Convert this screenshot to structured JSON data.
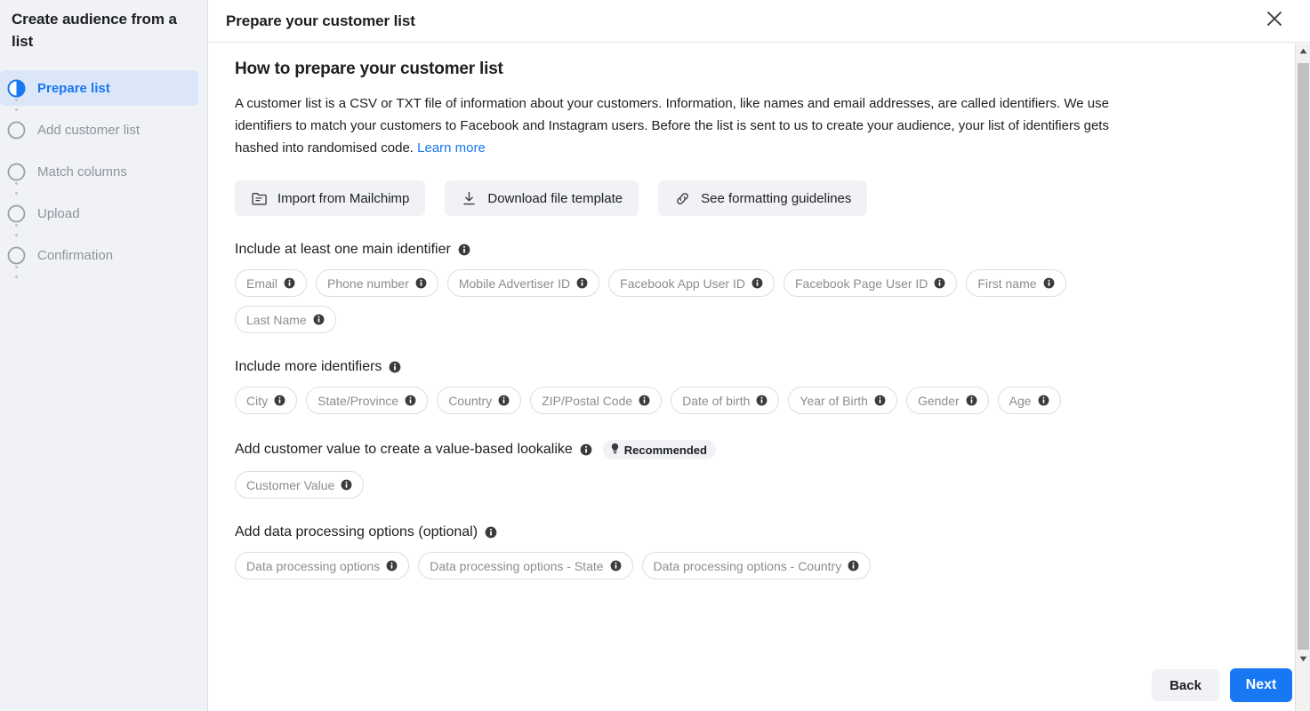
{
  "sidebar": {
    "title": "Create audience from a list",
    "steps": [
      {
        "label": "Prepare list",
        "state": "active",
        "icon": "half-filled-circle-icon"
      },
      {
        "label": "Add customer list",
        "state": "pending",
        "icon": "empty-circle-icon"
      },
      {
        "label": "Match columns",
        "state": "pending",
        "icon": "empty-circle-icon"
      },
      {
        "label": "Upload",
        "state": "pending",
        "icon": "empty-circle-icon"
      },
      {
        "label": "Confirmation",
        "state": "pending",
        "icon": "empty-circle-icon"
      }
    ]
  },
  "header": {
    "title": "Prepare your customer list",
    "close_icon": "close-icon"
  },
  "main": {
    "heading": "How to prepare your customer list",
    "intro_text": "A customer list is a CSV or TXT file of information about your customers. Information, like names and email addresses, are called identifiers. We use identifiers to match your customers to Facebook and Instagram users. Before the list is sent to us to create your audience, your list of identifiers gets hashed into randomised code. ",
    "intro_link": "Learn more",
    "actions": [
      {
        "label": "Import from Mailchimp",
        "icon": "folder-import-icon"
      },
      {
        "label": "Download file template",
        "icon": "download-icon"
      },
      {
        "label": "See formatting guidelines",
        "icon": "link-chain-icon"
      }
    ],
    "groups": [
      {
        "title": "Include at least one main identifier",
        "info_icon": "info-icon",
        "badge": null,
        "chips": [
          "Email",
          "Phone number",
          "Mobile Advertiser ID",
          "Facebook App User ID",
          "Facebook Page User ID",
          "First name",
          "Last Name"
        ]
      },
      {
        "title": "Include more identifiers",
        "info_icon": "info-icon",
        "badge": null,
        "chips": [
          "City",
          "State/Province",
          "Country",
          "ZIP/Postal Code",
          "Date of birth",
          "Year of Birth",
          "Gender",
          "Age"
        ]
      },
      {
        "title": "Add customer value to create a value-based lookalike",
        "info_icon": "info-icon",
        "badge": {
          "label": "Recommended",
          "icon": "lightbulb-icon"
        },
        "chips": [
          "Customer Value"
        ]
      },
      {
        "title": "Add data processing options (optional)",
        "info_icon": "info-icon",
        "badge": null,
        "chips": [
          "Data processing options",
          "Data processing options - State",
          "Data processing options - Country"
        ]
      }
    ]
  },
  "footer": {
    "back_label": "Back",
    "next_label": "Next"
  },
  "colors": {
    "accent": "#1877f2",
    "sidebar_bg": "#f0f2f5",
    "active_step_bg": "#dbe7f9",
    "chip_border": "#dadde1",
    "chip_text": "#8a8d91",
    "muted_text": "#8d949e",
    "body_text": "#1c1e21"
  }
}
